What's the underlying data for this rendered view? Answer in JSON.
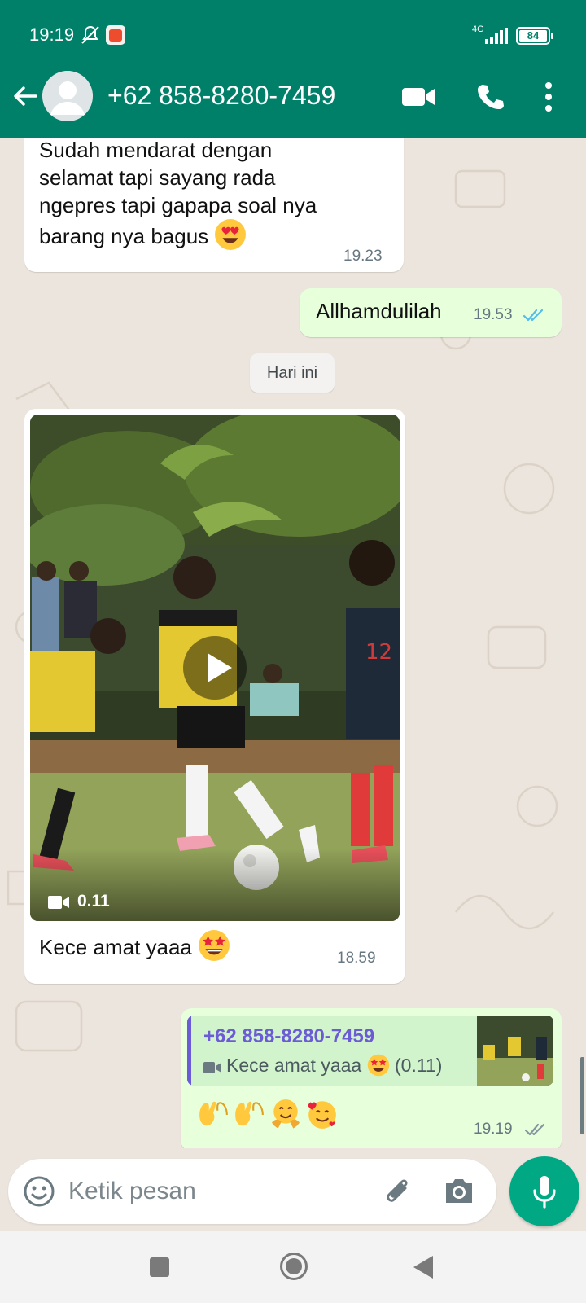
{
  "status_bar": {
    "time": "19:19",
    "network": "4G",
    "battery": "84"
  },
  "header": {
    "contact_name": "+62 858-8280-7459"
  },
  "colors": {
    "header": "#008069",
    "accent": "#00a884",
    "outgoing_bubble": "#e7ffdb",
    "read_ticks": "#53bdeb",
    "quote_accent": "#6b5bd6"
  },
  "icons": [
    "back-arrow-icon",
    "avatar-icon",
    "video-call-icon",
    "voice-call-icon",
    "more-vert-icon",
    "emoji-icon",
    "attach-icon",
    "camera-icon",
    "mic-icon"
  ],
  "messages": [
    {
      "direction": "in",
      "lines": [
        "Sudah mendarat dengan",
        "selamat tapi sayang rada",
        "ngepres tapi gapapa soal nya",
        "barang nya bagus"
      ],
      "emoji": "heart-eyes",
      "time": "19.23"
    },
    {
      "direction": "out",
      "text": "Allhamdulilah",
      "time": "19.53",
      "status": "read"
    },
    {
      "date_chip": "Hari ini"
    },
    {
      "direction": "in",
      "type": "video",
      "duration": "0.11",
      "caption": "Kece amat yaaa",
      "emoji": "star-struck",
      "time": "18.59"
    },
    {
      "direction": "out",
      "reply_to": {
        "sender": "+62 858-8280-7459",
        "text": "Kece amat yaaa",
        "emoji": "star-struck",
        "suffix": "(0.11)"
      },
      "emojis": [
        "raising-hands",
        "raising-hands",
        "hugging-face",
        "smiling-face-with-hearts"
      ],
      "time": "19.19",
      "status": "delivered"
    }
  ],
  "composer": {
    "placeholder": "Ketik pesan"
  }
}
